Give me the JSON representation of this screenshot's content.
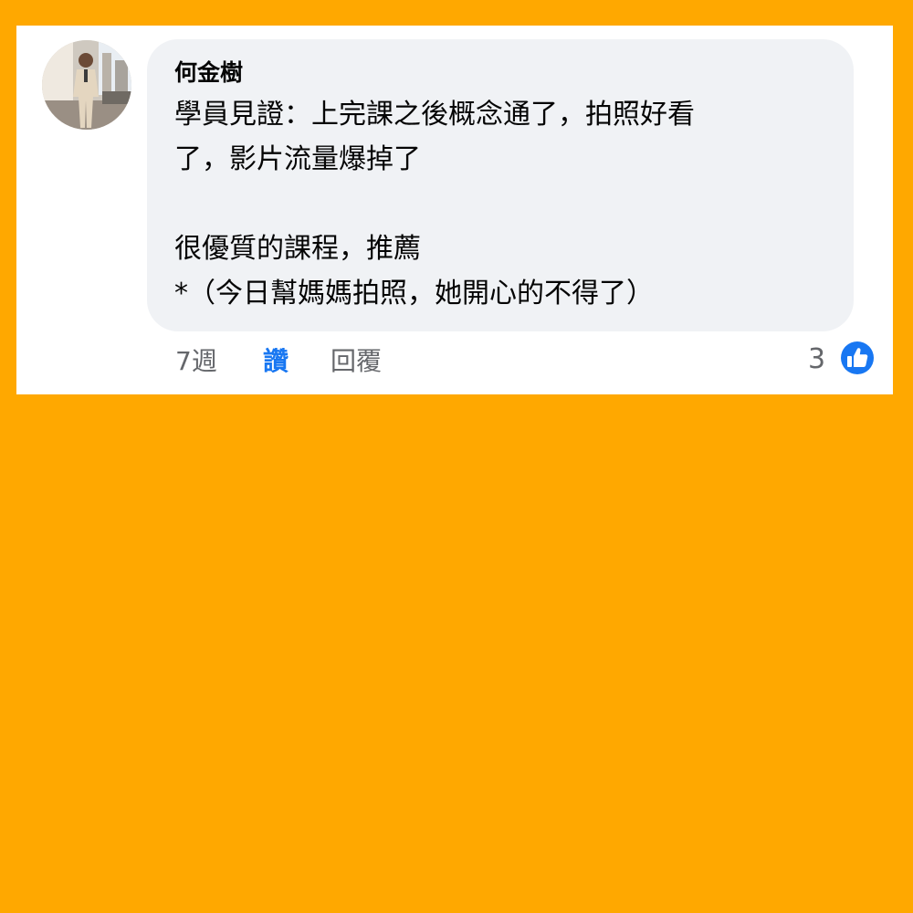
{
  "comment": {
    "author": "何金樹",
    "lines": [
      "學員見證：上完課之後概念通了，拍照好看",
      "了，影片流量爆掉了",
      "",
      "很優質的課程，推薦",
      "*（今日幫媽媽拍照，她開心的不得了）"
    ],
    "time": "7週",
    "like_label": "讚",
    "reply_label": "回覆",
    "reaction_count": "3",
    "reaction_icon": "thumbs-up-icon"
  },
  "colors": {
    "background": "#FFA800",
    "card": "#FFFFFF",
    "bubble": "#F0F2F5",
    "text": "#050505",
    "muted": "#65676B",
    "accent": "#1877F2"
  }
}
